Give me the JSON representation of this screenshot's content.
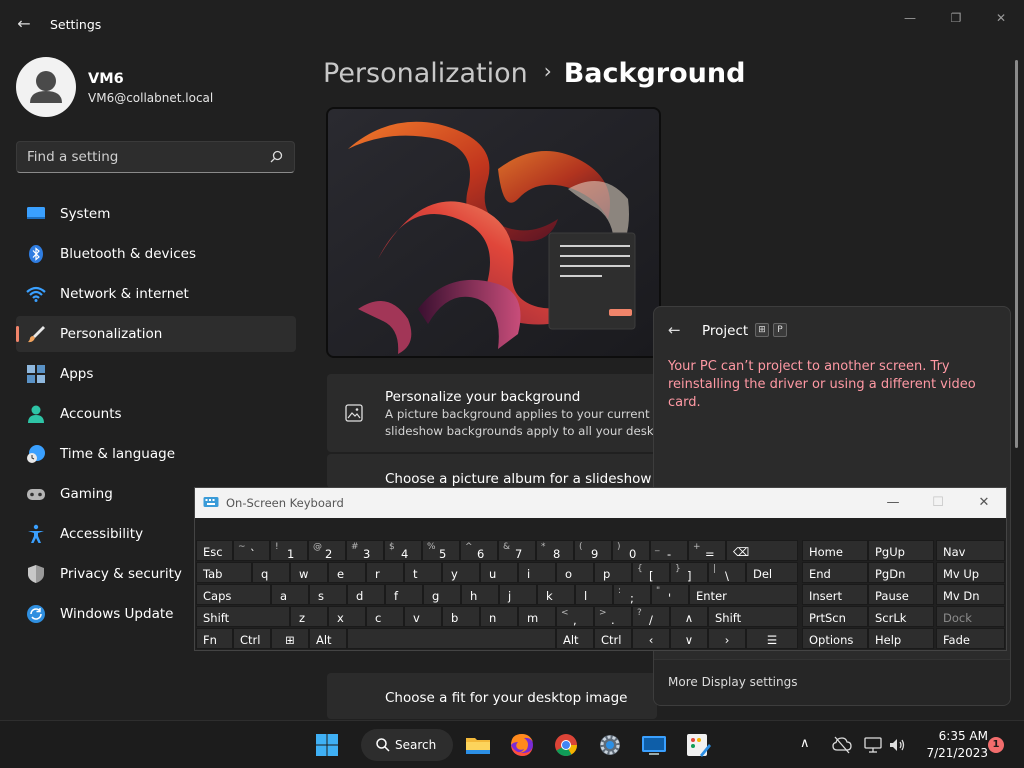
{
  "window": {
    "title": "Settings",
    "back_icon": "back-arrow-icon",
    "controls": {
      "minimize": "—",
      "maximize": "❐",
      "close": "✕"
    }
  },
  "profile": {
    "name": "VM6",
    "email": "VM6@collabnet.local",
    "avatar_icon": "user-avatar-icon"
  },
  "search": {
    "placeholder": "Find a setting",
    "icon": "search-icon"
  },
  "nav": {
    "items": [
      {
        "label": "System",
        "icon": "system-icon",
        "color": "#3aa0ff",
        "active": false
      },
      {
        "label": "Bluetooth & devices",
        "icon": "bluetooth-icon",
        "color": "#2f7de1",
        "active": false
      },
      {
        "label": "Network & internet",
        "icon": "wifi-icon",
        "color": "#3aa0ff",
        "active": false
      },
      {
        "label": "Personalization",
        "icon": "brush-icon",
        "color": "#f0a35e",
        "active": true
      },
      {
        "label": "Apps",
        "icon": "apps-icon",
        "color": "#8fb8de",
        "active": false
      },
      {
        "label": "Accounts",
        "icon": "accounts-icon",
        "color": "#2ec4a6",
        "active": false
      },
      {
        "label": "Time & language",
        "icon": "time-language-icon",
        "color": "#3aa0ff",
        "active": false
      },
      {
        "label": "Gaming",
        "icon": "gaming-icon",
        "color": "#b5b5b5",
        "active": false
      },
      {
        "label": "Accessibility",
        "icon": "accessibility-icon",
        "color": "#3aa0ff",
        "active": false
      },
      {
        "label": "Privacy & security",
        "icon": "shield-icon",
        "color": "#9a9a9a",
        "active": false
      },
      {
        "label": "Windows Update",
        "icon": "update-icon",
        "color": "#2f8fe0",
        "active": false
      }
    ]
  },
  "main": {
    "breadcrumb": {
      "parent": "Personalization",
      "separator": "›",
      "current": "Background"
    },
    "cards": {
      "personalize": {
        "title": "Personalize your background",
        "desc_line1": "A picture background applies to your current desk",
        "desc_line2": "slideshow backgrounds apply to all your desktops",
        "icon": "picture-icon"
      },
      "album_title": "Choose a picture album for a slideshow",
      "fit_title": "Choose a fit for your desktop image"
    }
  },
  "project_flyout": {
    "title": "Project",
    "back_icon": "back-arrow-icon",
    "shortcut": [
      "⊞",
      "P"
    ],
    "error": "Your PC can’t project to another screen. Try reinstalling the driver or using a different video card.",
    "more_link": "More Display settings",
    "error_color": "#ff99a4"
  },
  "osk": {
    "title": "On-Screen Keyboard",
    "icon": "keyboard-icon",
    "controls": {
      "minimize": "—",
      "maximize": "☐",
      "close": "✕"
    },
    "rows": [
      [
        "Esc",
        [
          "~",
          "`"
        ],
        [
          "!",
          "1"
        ],
        [
          "@",
          "2"
        ],
        [
          "#",
          "3"
        ],
        [
          "$",
          "4"
        ],
        [
          "%",
          "5"
        ],
        [
          "^",
          "6"
        ],
        [
          "&",
          "7"
        ],
        [
          "*",
          "8"
        ],
        [
          "(",
          "9"
        ],
        [
          ")",
          "0"
        ],
        [
          "_",
          "-"
        ],
        [
          "+",
          "="
        ],
        "⌫",
        "Home",
        "PgUp",
        "Nav"
      ],
      [
        "Tab",
        "q",
        "w",
        "e",
        "r",
        "t",
        "y",
        "u",
        "i",
        "o",
        "p",
        [
          "{",
          "["
        ],
        [
          "}",
          "]"
        ],
        [
          "|",
          "\\"
        ],
        "Del",
        "End",
        "PgDn",
        "Mv Up"
      ],
      [
        "Caps",
        "a",
        "s",
        "d",
        "f",
        "g",
        "h",
        "j",
        "k",
        "l",
        [
          ":",
          ";"
        ],
        [
          "\"",
          "'"
        ],
        "Enter",
        "Insert",
        "Pause",
        "Mv Dn"
      ],
      [
        "Shift",
        "z",
        "x",
        "c",
        "v",
        "b",
        "n",
        "m",
        [
          "<",
          ","
        ],
        [
          ">",
          "."
        ],
        [
          "?",
          "/"
        ],
        "∧",
        "Shift",
        "PrtScn",
        "ScrLk",
        "Dock"
      ],
      [
        "Fn",
        "Ctrl",
        "⊞",
        "Alt",
        "",
        "Alt",
        "Ctrl",
        "‹",
        "∨",
        "›",
        "☰",
        "Options",
        "Help",
        "Fade"
      ]
    ]
  },
  "taskbar": {
    "search_label": "Search",
    "apps": [
      "windows-start-icon",
      "file-explorer-icon",
      "firefox-icon",
      "chrome-icon",
      "settings-gear-icon",
      "remote-desktop-icon",
      "paint-icon"
    ],
    "tray": [
      "chevron-up-icon",
      "cloud-off-icon",
      "network-icon",
      "volume-icon"
    ],
    "time": "6:35 AM",
    "date": "7/21/2023",
    "notification_count": "1"
  },
  "colors": {
    "accent": "#f0846a",
    "background": "#202020",
    "card": "#2b2b2b"
  }
}
